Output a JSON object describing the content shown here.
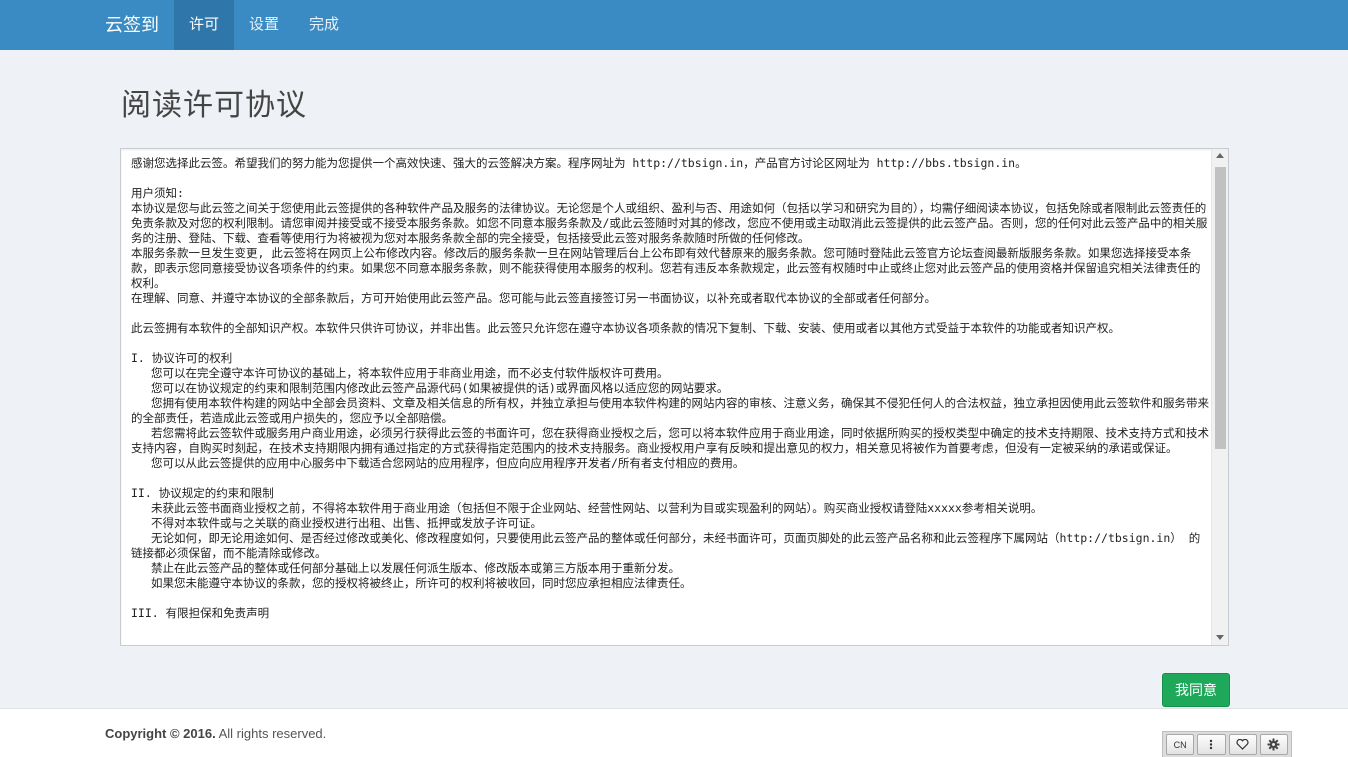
{
  "navbar": {
    "brand": "云签到",
    "items": [
      {
        "label": "许可",
        "active": true
      },
      {
        "label": "设置",
        "active": false
      },
      {
        "label": "完成",
        "active": false
      }
    ]
  },
  "page": {
    "title": "阅读许可协议"
  },
  "license": {
    "lines": [
      {
        "type": "para",
        "text": "感谢您选择此云签。希望我们的努力能为您提供一个高效快速、强大的云签解决方案。程序网址为 http://tbsign.in，产品官方讨论区网址为 http://bbs.tbsign.in。"
      },
      {
        "type": "gap",
        "text": ""
      },
      {
        "type": "para",
        "text": "用户须知:"
      },
      {
        "type": "para",
        "text": "本协议是您与此云签之间关于您使用此云签提供的各种软件产品及服务的法律协议。无论您是个人或组织、盈利与否、用途如何（包括以学习和研究为目的），均需仔细阅读本协议，包括免除或者限制此云签责任的免责条款及对您的权利限制。请您审阅并接受或不接受本服务条款。如您不同意本服务条款及/或此云签随时对其的修改，您应不使用或主动取消此云签提供的此云签产品。否则，您的任何对此云签产品中的相关服务的注册、登陆、下载、查看等使用行为将被视为您对本服务条款全部的完全接受，包括接受此云签对服务条款随时所做的任何修改。"
      },
      {
        "type": "para",
        "text": "本服务条款一旦发生变更, 此云签将在网页上公布修改内容。修改后的服务条款一旦在网站管理后台上公布即有效代替原来的服务条款。您可随时登陆此云签官方论坛查阅最新版服务条款。如果您选择接受本条款，即表示您同意接受协议各项条件的约束。如果您不同意本服务条款，则不能获得使用本服务的权利。您若有违反本条款规定，此云签有权随时中止或终止您对此云签产品的使用资格并保留追究相关法律责任的权利。"
      },
      {
        "type": "para",
        "text": "在理解、同意、并遵守本协议的全部条款后，方可开始使用此云签产品。您可能与此云签直接签订另一书面协议，以补充或者取代本协议的全部或者任何部分。"
      },
      {
        "type": "gap",
        "text": ""
      },
      {
        "type": "para",
        "text": "此云签拥有本软件的全部知识产权。本软件只供许可协议，并非出售。此云签只允许您在遵守本协议各项条款的情况下复制、下载、安装、使用或者以其他方式受益于本软件的功能或者知识产权。"
      },
      {
        "type": "gap",
        "text": ""
      },
      {
        "type": "para",
        "text": "I. 协议许可的权利"
      },
      {
        "type": "ind",
        "text": "您可以在完全遵守本许可协议的基础上，将本软件应用于非商业用途，而不必支付软件版权许可费用。"
      },
      {
        "type": "ind",
        "text": "您可以在协议规定的约束和限制范围内修改此云签产品源代码(如果被提供的话)或界面风格以适应您的网站要求。"
      },
      {
        "type": "hang",
        "text": "您拥有使用本软件构建的网站中全部会员资料、文章及相关信息的所有权，并独立承担与使用本软件构建的网站内容的审核、注意义务，确保其不侵犯任何人的合法权益，独立承担因使用此云签软件和服务带来的全部责任，若造成此云签或用户损失的，您应予以全部赔偿。"
      },
      {
        "type": "hang",
        "text": "若您需将此云签软件或服务用户商业用途，必须另行获得此云签的书面许可，您在获得商业授权之后，您可以将本软件应用于商业用途，同时依据所购买的授权类型中确定的技术支持期限、技术支持方式和技术支持内容，自购买时刻起，在技术支持期限内拥有通过指定的方式获得指定范围内的技术支持服务。商业授权用户享有反映和提出意见的权力，相关意见将被作为首要考虑，但没有一定被采纳的承诺或保证。"
      },
      {
        "type": "ind",
        "text": "您可以从此云签提供的应用中心服务中下载适合您网站的应用程序，但应向应用程序开发者/所有者支付相应的费用。"
      },
      {
        "type": "gap",
        "text": ""
      },
      {
        "type": "para",
        "text": "II. 协议规定的约束和限制"
      },
      {
        "type": "ind",
        "text": "未获此云签书面商业授权之前，不得将本软件用于商业用途（包括但不限于企业网站、经营性网站、以营利为目或实现盈利的网站）。购买商业授权请登陆xxxxx参考相关说明。"
      },
      {
        "type": "ind",
        "text": "不得对本软件或与之关联的商业授权进行出租、出售、抵押或发放子许可证。"
      },
      {
        "type": "hang",
        "text": "无论如何，即无论用途如何、是否经过修改或美化、修改程度如何，只要使用此云签产品的整体或任何部分，未经书面许可，页面页脚处的此云签产品名称和此云签程序下属网站（http://tbsign.in） 的链接都必须保留，而不能清除或修改。"
      },
      {
        "type": "ind",
        "text": "禁止在此云签产品的整体或任何部分基础上以发展任何派生版本、修改版本或第三方版本用于重新分发。"
      },
      {
        "type": "ind",
        "text": "如果您未能遵守本协议的条款，您的授权将被终止，所许可的权利将被收回，同时您应承担相应法律责任。"
      },
      {
        "type": "gap",
        "text": ""
      },
      {
        "type": "para",
        "text": "III. 有限担保和免责声明"
      }
    ]
  },
  "actions": {
    "agree_label": "我同意"
  },
  "footer": {
    "copyright_bold": "Copyright © 2016.",
    "copyright_rest": " All rights reserved.",
    "toolbar": [
      {
        "label": "CN",
        "icon": "language-icon"
      },
      {
        "label": "",
        "icon": "more-vertical-icon"
      },
      {
        "label": "",
        "icon": "heart-icon"
      },
      {
        "label": "",
        "icon": "gear-icon"
      }
    ]
  }
}
